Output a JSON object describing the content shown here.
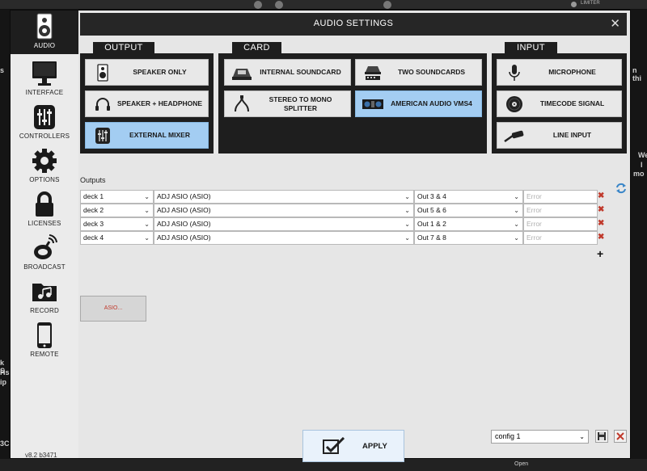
{
  "background": {
    "limiter_label": "LIMITER",
    "left_peek": [
      "s",
      "k S",
      "Hs",
      "ip",
      "3C"
    ],
    "right_peek": [
      "n thi",
      "We",
      "l",
      "mo"
    ],
    "bottom_peek": [
      "Open"
    ]
  },
  "dialog": {
    "title": "AUDIO SETTINGS",
    "close_glyph": "✕"
  },
  "sidebar": {
    "items": [
      {
        "label": "AUDIO",
        "icon": "speaker-icon",
        "active": true
      },
      {
        "label": "INTERFACE",
        "icon": "monitor-icon",
        "active": false
      },
      {
        "label": "CONTROLLERS",
        "icon": "sliders-icon",
        "active": false
      },
      {
        "label": "OPTIONS",
        "icon": "gear-icon",
        "active": false
      },
      {
        "label": "LICENSES",
        "icon": "lock-icon",
        "active": false
      },
      {
        "label": "BROADCAST",
        "icon": "broadcast-icon",
        "active": false
      },
      {
        "label": "RECORD",
        "icon": "folder-music-icon",
        "active": false
      },
      {
        "label": "REMOTE",
        "icon": "tablet-icon",
        "active": false
      }
    ],
    "version": "v8.2 b3471"
  },
  "sections": {
    "output": {
      "title": "OUTPUT",
      "options": [
        {
          "label": "SPEAKER ONLY",
          "icon": "speaker-icon",
          "selected": false
        },
        {
          "label": "SPEAKER + HEADPHONE",
          "icon": "headphone-icon",
          "selected": false
        },
        {
          "label": "EXTERNAL MIXER",
          "icon": "mixer-icon",
          "selected": true
        }
      ]
    },
    "card": {
      "title": "CARD",
      "options": [
        {
          "label": "INTERNAL SOUNDCARD",
          "icon": "internal-soundcard-icon",
          "selected": false
        },
        {
          "label": "TWO SOUNDCARDS",
          "icon": "two-soundcards-icon",
          "selected": false
        },
        {
          "label": "STEREO TO MONO SPLITTER",
          "icon": "splitter-cable-icon",
          "selected": false
        },
        {
          "label": "AMERICAN AUDIO VMS4",
          "icon": "controller-device-icon",
          "selected": true
        }
      ]
    },
    "input": {
      "title": "INPUT",
      "options": [
        {
          "label": "MICROPHONE",
          "icon": "microphone-icon",
          "selected": false
        },
        {
          "label": "TIMECODE SIGNAL",
          "icon": "vinyl-icon",
          "selected": false
        },
        {
          "label": "LINE INPUT",
          "icon": "cable-plug-icon",
          "selected": false
        }
      ]
    }
  },
  "outputs": {
    "label": "Outputs",
    "rows": [
      {
        "deck": "deck 1",
        "device": "ADJ ASIO (ASIO)",
        "channel": "Out 3 & 4",
        "status_placeholder": "Error"
      },
      {
        "deck": "deck 2",
        "device": "ADJ ASIO (ASIO)",
        "channel": "Out 5 & 6",
        "status_placeholder": "Error"
      },
      {
        "deck": "deck 3",
        "device": "ADJ ASIO (ASIO)",
        "channel": "Out 1 & 2",
        "status_placeholder": "Error"
      },
      {
        "deck": "deck 4",
        "device": "ADJ ASIO (ASIO)",
        "channel": "Out 7 & 8",
        "status_placeholder": "Error"
      }
    ],
    "add_glyph": "+",
    "delete_glyph": "✖"
  },
  "asio_button_label": "ASIO...",
  "apply_label": "APPLY",
  "config": {
    "selected": "config 1"
  },
  "colors": {
    "selected_option": "#a3cdf2",
    "panel_dark": "#1e1e1e",
    "delete_red": "#c0392b"
  }
}
